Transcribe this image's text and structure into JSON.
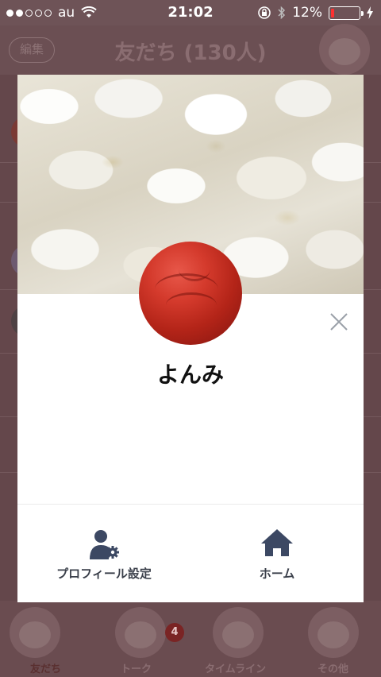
{
  "status_bar": {
    "carrier": "au",
    "time": "21:02",
    "battery_percent": "12%",
    "battery_level": 0.12,
    "signal_dots_filled": 2,
    "signal_dots_total": 5
  },
  "background": {
    "edit_label": "編集",
    "title": "友だち (130人)",
    "tabs": [
      {
        "label": "友だち",
        "active": true
      },
      {
        "label": "トーク",
        "badge": "4"
      },
      {
        "label": "タイムライン"
      },
      {
        "label": "その他"
      }
    ]
  },
  "profile": {
    "name": "よんみ",
    "actions": [
      {
        "label": "プロフィール設定",
        "icon": "profile-settings-icon"
      },
      {
        "label": "ホーム",
        "icon": "home-icon"
      }
    ]
  },
  "colors": {
    "accent": "#3c4863",
    "overlay": "#5a3c40",
    "battery_low": "#ff3030"
  }
}
